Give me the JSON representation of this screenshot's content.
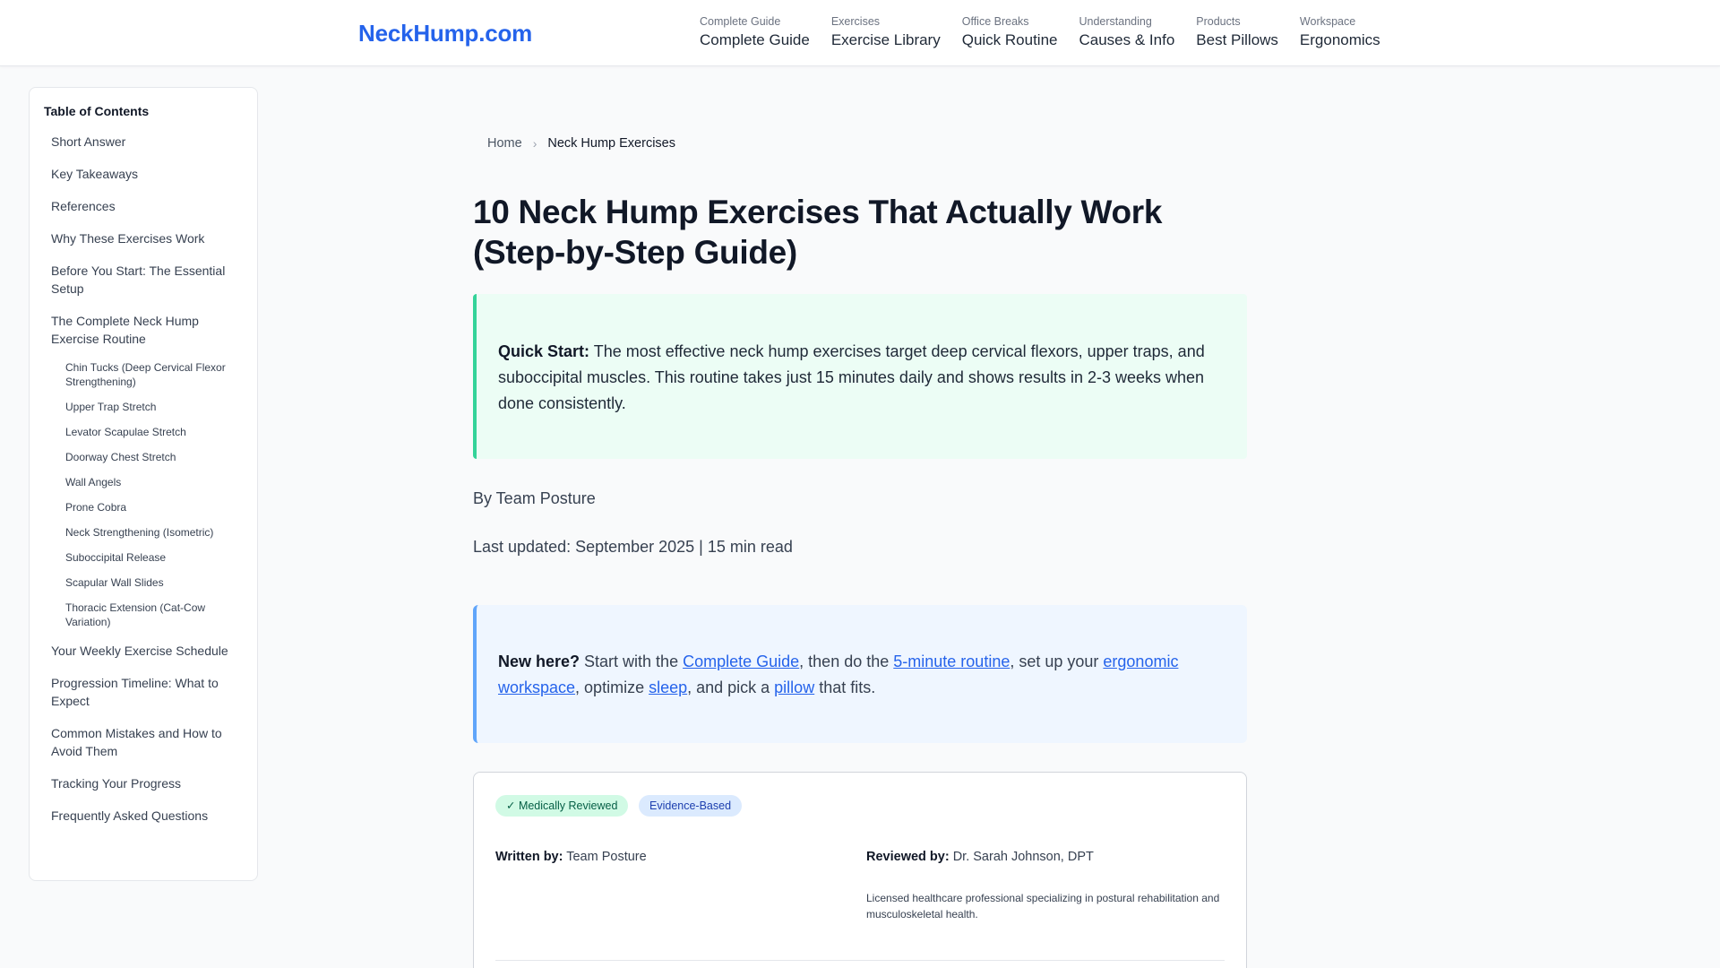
{
  "header": {
    "logo": "NeckHump.com",
    "nav": [
      {
        "kicker": "Complete Guide",
        "label": "Complete Guide"
      },
      {
        "kicker": "Exercises",
        "label": "Exercise Library"
      },
      {
        "kicker": "Office Breaks",
        "label": "Quick Routine"
      },
      {
        "kicker": "Understanding",
        "label": "Causes & Info"
      },
      {
        "kicker": "Products",
        "label": "Best Pillows"
      },
      {
        "kicker": "Workspace",
        "label": "Ergonomics"
      }
    ]
  },
  "toc": {
    "title": "Table of Contents",
    "items": [
      "Short Answer",
      "Key Takeaways",
      "References",
      "Why These Exercises Work",
      "Before You Start: The Essential Setup",
      "The Complete Neck Hump Exercise Routine"
    ],
    "subitems": [
      "Chin Tucks (Deep Cervical Flexor Strengthening)",
      "Upper Trap Stretch",
      "Levator Scapulae Stretch",
      "Doorway Chest Stretch",
      "Wall Angels",
      "Prone Cobra",
      "Neck Strengthening (Isometric)",
      "Suboccipital Release",
      "Scapular Wall Slides",
      "Thoracic Extension (Cat-Cow Variation)"
    ],
    "items_after": [
      "Your Weekly Exercise Schedule",
      "Progression Timeline: What to Expect",
      "Common Mistakes and How to Avoid Them",
      "Tracking Your Progress",
      "Frequently Asked Questions"
    ]
  },
  "breadcrumb": {
    "home": "Home",
    "separator": "›",
    "current": "Neck Hump Exercises"
  },
  "article": {
    "title": "10 Neck Hump Exercises That Actually Work (Step-by-Step Guide)",
    "quickstart": {
      "label": "Quick Start:",
      "text": " The most effective neck hump exercises target deep cervical flexors, upper traps, and suboccipital muscles. This routine takes just 15 minutes daily and shows results in 2-3 weeks when done consistently."
    },
    "byline": "By Team Posture",
    "updated": "Last updated: September 2025 | 15 min read",
    "newhere": {
      "label": "New here?",
      "t1": " Start with the ",
      "link1": "Complete Guide",
      "t2": ", then do the ",
      "link2": "5-minute routine",
      "t3": ", set up your ",
      "link3": "ergonomic workspace",
      "t4": ", optimize ",
      "link4": "sleep",
      "t5": ", and pick a ",
      "link5": "pillow",
      "t6": " that fits."
    }
  },
  "review": {
    "badge_medical": "✓ Medically Reviewed",
    "badge_evidence": "Evidence-Based",
    "written_label": "Written by:",
    "written_value": " Team Posture",
    "reviewed_label": "Reviewed by:",
    "reviewed_value": " Dr. Sarah Johnson, DPT",
    "reviewer_desc": "Licensed healthcare professional specializing in postural rehabilitation and musculoskeletal health."
  }
}
